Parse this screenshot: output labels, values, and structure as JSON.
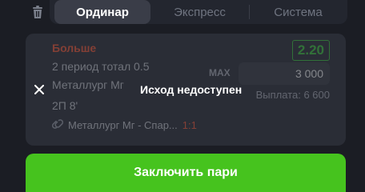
{
  "tabs": [
    {
      "label": "Ординар",
      "active": true
    },
    {
      "label": "Экспресс",
      "active": false
    },
    {
      "label": "Система",
      "active": false
    }
  ],
  "bet": {
    "outcome": "Больше",
    "market": "2 период тотал 0.5",
    "team": "Металлург Мг",
    "period_time": "2П 8'",
    "odds": "2.20",
    "stake_max_label": "MAX",
    "stake_value": "3 000",
    "payout_text": "Выплата: 6 600",
    "event_name": "Металлург Мг - Спар...",
    "event_score": "1:1",
    "unavailable_text": "Исход недоступен"
  },
  "actions": {
    "place_bet": "Заключить пари"
  },
  "colors": {
    "background": "#1b1d24",
    "card": "#2a2d36",
    "accent_green": "#46c31e",
    "odds_green": "#3ecf3e",
    "outcome_red": "#ff5a36"
  },
  "icons": {
    "trash": "trash-icon",
    "close": "close-icon",
    "link": "link-icon"
  }
}
